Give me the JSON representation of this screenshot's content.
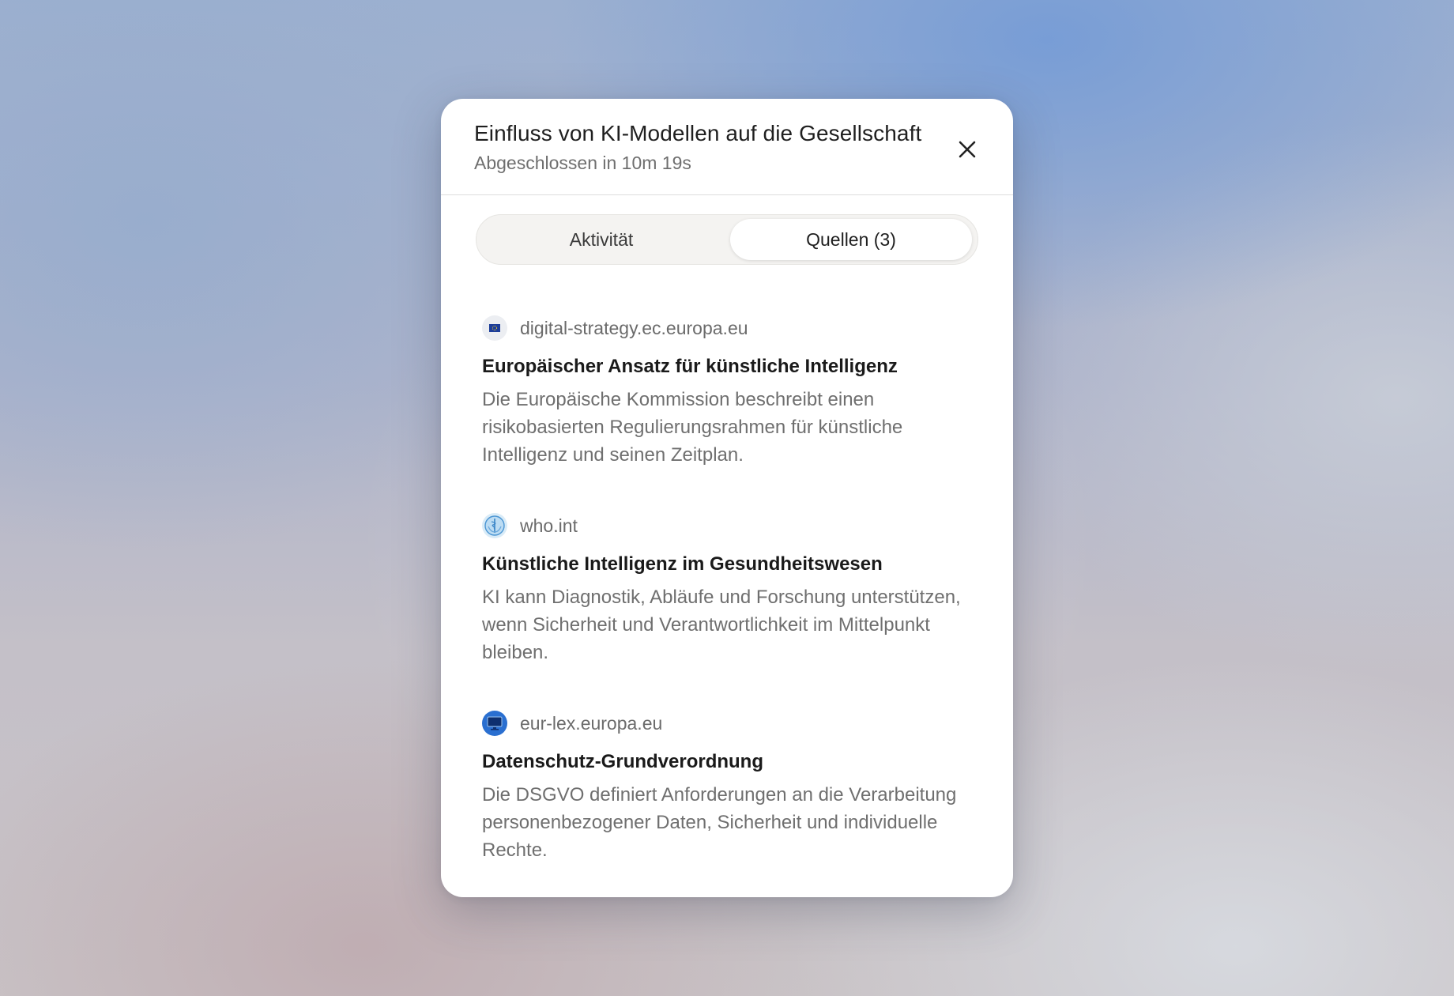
{
  "dialog": {
    "title": "Einfluss von KI-Modellen auf die Gesellschaft",
    "subtitle": "Abgeschlossen in 10m 19s",
    "close_icon": "close-icon"
  },
  "tabs": [
    {
      "label": "Aktivität",
      "active": false
    },
    {
      "label": "Quellen (3)",
      "active": true
    }
  ],
  "sources": [
    {
      "icon": "eu-flag-icon",
      "domain": "digital-strategy.ec.europa.eu",
      "title": "Europäischer Ansatz für künstliche Intelligenz",
      "snippet": "Die Europäische Kommission beschreibt einen risikobasierten Regulierungsrahmen für künstliche Intelligenz und seinen Zeitplan."
    },
    {
      "icon": "who-emblem-icon",
      "domain": "who.int",
      "title": "Künstliche Intelligenz im Gesundheitswesen",
      "snippet": "KI kann Diagnostik, Abläufe und Forschung unterstützen, wenn Sicherheit und Verantwortlichkeit im Mittelpunkt bleiben."
    },
    {
      "icon": "eur-lex-monitor-icon",
      "domain": "eur-lex.europa.eu",
      "title": "Datenschutz-Grundverordnung",
      "snippet": "Die DSGVO definiert Anforderungen an die Verarbeitung personenbezogener Daten, Sicherheit und individuelle Rechte."
    }
  ],
  "colors": {
    "dialog_bg": "#ffffff",
    "title_text": "#1f1f1f",
    "muted_text": "#6f6f6f",
    "tab_track": "#f4f3f1"
  }
}
